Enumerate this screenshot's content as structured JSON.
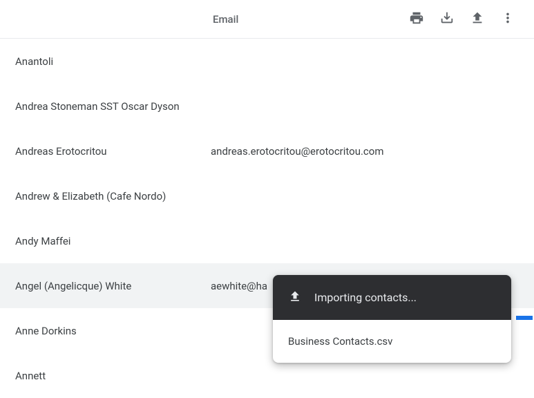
{
  "header": {
    "column_label": "Email"
  },
  "contacts": [
    {
      "name": "Anantoli",
      "email": ""
    },
    {
      "name": "Andrea Stoneman SST Oscar Dyson",
      "email": ""
    },
    {
      "name": "Andreas Erotocritou",
      "email": "andreas.erotocritou@erotocritou.com"
    },
    {
      "name": "Andrew & Elizabeth (Cafe Nordo)",
      "email": ""
    },
    {
      "name": "Andy Maffei",
      "email": ""
    },
    {
      "name": "Angel (Angelicque) White",
      "email": "aewhite@ha"
    },
    {
      "name": "Anne Dorkins",
      "email": ""
    },
    {
      "name": "Annett",
      "email": ""
    }
  ],
  "highlighted_index": 5,
  "toast": {
    "title": "Importing contacts...",
    "file": "Business Contacts.csv"
  }
}
